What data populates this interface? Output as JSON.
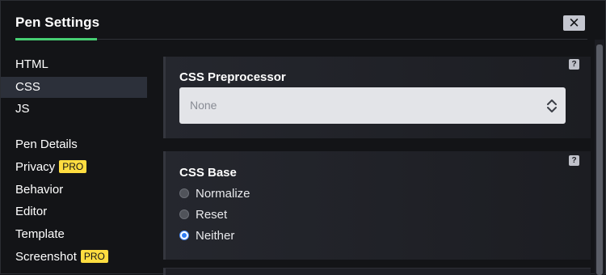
{
  "header": {
    "title": "Pen Settings",
    "close_label": "✕"
  },
  "sidebar": {
    "top_items": [
      {
        "label": "HTML",
        "active": false
      },
      {
        "label": "CSS",
        "active": true
      },
      {
        "label": "JS",
        "active": false
      }
    ],
    "bottom_items": [
      {
        "label": "Pen Details",
        "badge": ""
      },
      {
        "label": "Privacy",
        "badge": "PRO"
      },
      {
        "label": "Behavior",
        "badge": ""
      },
      {
        "label": "Editor",
        "badge": ""
      },
      {
        "label": "Template",
        "badge": ""
      },
      {
        "label": "Screenshot",
        "badge": "PRO"
      }
    ]
  },
  "preprocessor": {
    "label": "CSS Preprocessor",
    "help": "?",
    "selected": "None"
  },
  "base": {
    "label": "CSS Base",
    "help": "?",
    "options": [
      {
        "label": "Normalize",
        "checked": false
      },
      {
        "label": "Reset",
        "checked": false
      },
      {
        "label": "Neither",
        "checked": true
      }
    ]
  },
  "colors": {
    "accent": "#47cf73",
    "pro_badge": "#ffdd40",
    "radio_selected": "#2e7cf6"
  }
}
